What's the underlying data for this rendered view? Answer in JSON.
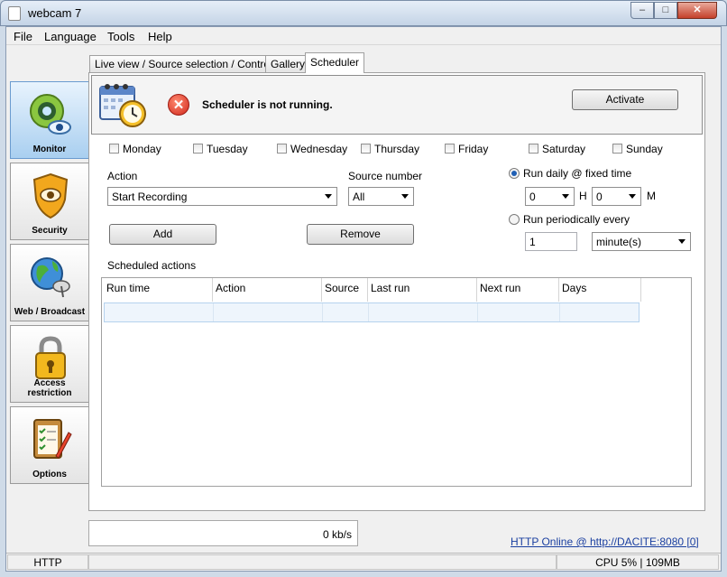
{
  "window": {
    "title": "webcam 7",
    "minimize": "–",
    "maximize": "□",
    "close": "✕"
  },
  "menu": [
    "File",
    "Language",
    "Tools",
    "Help"
  ],
  "sidebar": [
    {
      "label": "Monitor",
      "icon": "eye-camera-icon",
      "active": true
    },
    {
      "label": "Security",
      "icon": "shield-eye-icon",
      "active": false
    },
    {
      "label": "Web / Broadcast",
      "icon": "globe-satellite-icon",
      "active": false
    },
    {
      "label": "Access restriction",
      "icon": "padlock-icon",
      "active": false
    },
    {
      "label": "Options",
      "icon": "checklist-pencil-icon",
      "active": false
    }
  ],
  "tabs": [
    {
      "label": "Live view / Source selection / Controls",
      "active": false
    },
    {
      "label": "Gallery",
      "active": false
    },
    {
      "label": "Scheduler",
      "active": true
    }
  ],
  "scheduler": {
    "status": "Scheduler is not running.",
    "activate_label": "Activate",
    "days": [
      "Monday",
      "Tuesday",
      "Wednesday",
      "Thursday",
      "Friday",
      "Saturday",
      "Sunday"
    ],
    "action_label": "Action",
    "action_value": "Start Recording",
    "source_label": "Source number",
    "source_value": "All",
    "add_label": "Add",
    "remove_label": "Remove",
    "run_daily_label": "Run daily @ fixed time",
    "hour_value": "0",
    "hour_unit": "H",
    "minute_value": "0",
    "minute_unit": "M",
    "run_periodic_label": "Run periodically every",
    "period_value": "1",
    "period_unit": "minute(s)",
    "scheduled_label": "Scheduled actions",
    "columns": [
      "Run time",
      "Action",
      "Source",
      "Last run",
      "Next run",
      "Days"
    ]
  },
  "footer": {
    "bitrate": "0 kb/s",
    "online_link": "HTTP Online @ http://DACITE:8080 [0]",
    "status_http": "HTTP",
    "status_cpu": "CPU 5% | 109MB"
  }
}
